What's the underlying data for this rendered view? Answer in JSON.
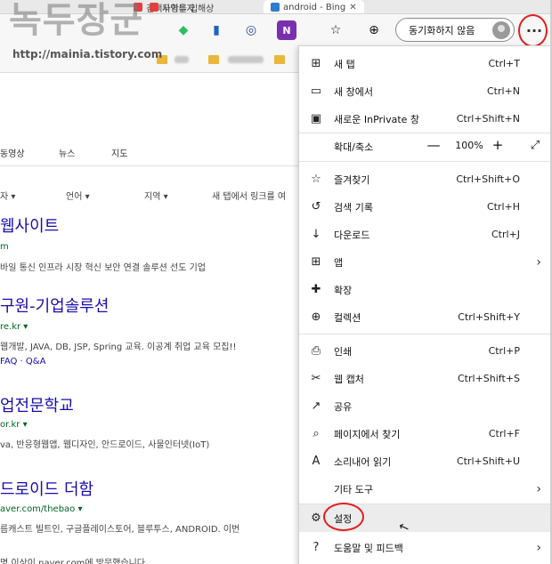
{
  "watermark": {
    "title": "녹두장군",
    "url": "http://mainia.tistory.com"
  },
  "tabs": [
    {
      "label": "검색사항을 입",
      "color": "#e04040"
    },
    {
      "label": "무역투자 해상",
      "color": "#e04040"
    },
    {
      "label": "android - Bing",
      "color": "#2e7bcf",
      "active": true
    }
  ],
  "toolbar": {
    "sync_label": "동기화하지 않음",
    "more_label": "···"
  },
  "page": {
    "nav": [
      "동영상",
      "뉴스",
      "지도"
    ],
    "filters": [
      "자",
      "언어",
      "지역",
      "새 탭에서 링크를 여"
    ],
    "results": [
      {
        "title": "웹사이트",
        "url": "m",
        "desc": "바일 통신 인프라 시장 혁신 보안 연결 솔루션 선도 기업"
      },
      {
        "title": "구원-기업솔루션",
        "url": "re.kr",
        "desc": "웹개발, JAVA, DB, JSP, Spring 교육. 이공계 취업 교육 모집!!",
        "links": "FAQ · Q&A"
      },
      {
        "title": "업전문학교",
        "url": "or.kr",
        "desc": "va, 반응형웹앱, 웹디자인, 안드로이드, 사물인터넷(IoT)"
      },
      {
        "title": "드로이드 더함",
        "url": "aver.com/thebao",
        "desc": "름캐스트 빌트인, 구글플레이스토어, 블루투스, ANDROID. 이번",
        "extra": "명 이상이 naver.com에 방문했습니다"
      }
    ]
  },
  "menu": {
    "items": [
      {
        "icon": "new-tab-icon",
        "glyph": "⊞",
        "label": "새 탭",
        "shortcut": "Ctrl+T"
      },
      {
        "icon": "new-window-icon",
        "glyph": "▭",
        "label": "새 창에서",
        "shortcut": "Ctrl+N"
      },
      {
        "icon": "inprivate-icon",
        "glyph": "▣",
        "label": "새로운 InPrivate 창",
        "shortcut": "Ctrl+Shift+N"
      },
      {
        "icon": "favorites-icon",
        "glyph": "☆",
        "label": "즐겨찾기",
        "shortcut": "Ctrl+Shift+O"
      },
      {
        "icon": "history-icon",
        "glyph": "↺",
        "label": "검색 기록",
        "shortcut": "Ctrl+H"
      },
      {
        "icon": "download-icon",
        "glyph": "↓",
        "label": "다운로드",
        "shortcut": "Ctrl+J"
      },
      {
        "icon": "apps-icon",
        "glyph": "⊞",
        "label": "앱",
        "shortcut": ""
      },
      {
        "icon": "extensions-icon",
        "glyph": "✚",
        "label": "확장",
        "shortcut": ""
      },
      {
        "icon": "collections-icon",
        "glyph": "⊕",
        "label": "컬렉션",
        "shortcut": "Ctrl+Shift+Y"
      },
      {
        "icon": "print-icon",
        "glyph": "⎙",
        "label": "인쇄",
        "shortcut": "Ctrl+P"
      },
      {
        "icon": "web-capture-icon",
        "glyph": "✂",
        "label": "웹 캡처",
        "shortcut": "Ctrl+Shift+S"
      },
      {
        "icon": "share-icon",
        "glyph": "↗",
        "label": "공유",
        "shortcut": ""
      },
      {
        "icon": "find-on-page-icon",
        "glyph": "⌕",
        "label": "페이지에서 찾기",
        "shortcut": "Ctrl+F"
      },
      {
        "icon": "read-aloud-icon",
        "glyph": "A",
        "label": "소리내어 읽기",
        "shortcut": "Ctrl+Shift+U"
      },
      {
        "icon": "",
        "glyph": "",
        "label": "기타 도구",
        "shortcut": ""
      },
      {
        "icon": "settings-icon",
        "glyph": "⚙",
        "label": "설정",
        "shortcut": ""
      },
      {
        "icon": "help-icon",
        "glyph": "?",
        "label": "도움말 및 피드백",
        "shortcut": ""
      }
    ],
    "zoom": {
      "label": "확대/축소",
      "value": "100%",
      "minus": "—",
      "plus": "+",
      "fullscreen": "⤢"
    }
  },
  "colors": {
    "link": "#1a0dab",
    "url": "#006621",
    "highlight_ring": "#e02020",
    "hover_row": "#ececec"
  }
}
